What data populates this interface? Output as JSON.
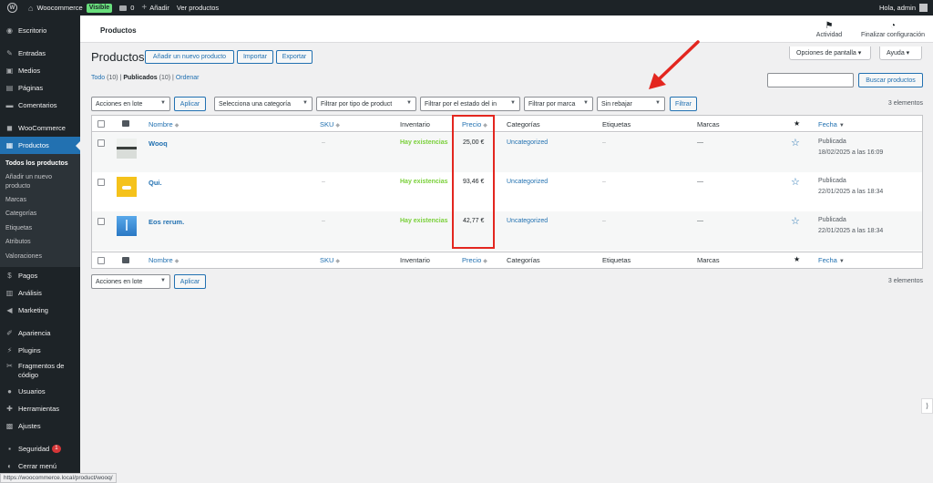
{
  "admin_bar": {
    "site_name": "Woocommerce",
    "visibility_badge": "Visible",
    "comments_count": "0",
    "new_label": "Añadir",
    "view_products": "Ver productos",
    "greeting": "Hola, admin"
  },
  "sidebar": {
    "items": [
      {
        "label": "Escritorio",
        "icon": "dashboard-icon"
      },
      {
        "label": "Entradas",
        "icon": "pin-icon"
      },
      {
        "label": "Medios",
        "icon": "media-icon"
      },
      {
        "label": "Páginas",
        "icon": "pages-icon"
      },
      {
        "label": "Comentarios",
        "icon": "comment-icon"
      },
      {
        "label": "WooCommerce",
        "icon": "woo-icon"
      },
      {
        "label": "Productos",
        "icon": "products-icon"
      }
    ],
    "submenu": [
      "Todos los productos",
      "Añadir un nuevo producto",
      "Marcas",
      "Categorías",
      "Etiquetas",
      "Atributos",
      "Valoraciones"
    ],
    "items_after": [
      {
        "label": "Pagos",
        "icon": "payments-icon"
      },
      {
        "label": "Análisis",
        "icon": "analytics-icon"
      },
      {
        "label": "Marketing",
        "icon": "megaphone-icon"
      },
      {
        "label": "Apariencia",
        "icon": "brush-icon"
      },
      {
        "label": "Plugins",
        "icon": "plugin-icon"
      },
      {
        "label": "Fragmentos de código",
        "icon": "code-icon"
      },
      {
        "label": "Usuarios",
        "icon": "users-icon"
      },
      {
        "label": "Herramientas",
        "icon": "wrench-icon"
      },
      {
        "label": "Ajustes",
        "icon": "settings-icon"
      },
      {
        "label": "Seguridad",
        "icon": "shield-icon",
        "badge": "1"
      },
      {
        "label": "Cerrar menú",
        "icon": "collapse-icon"
      }
    ]
  },
  "header": {
    "title": "Productos",
    "activity": "Actividad",
    "finish_setup": "Finalizar configuración",
    "screen_options": "Opciones de pantalla ▾",
    "help": "Ayuda ▾"
  },
  "page": {
    "title": "Productos",
    "add_new": "Añadir un nuevo producto",
    "import": "Importar",
    "export": "Exportar",
    "filters": {
      "all": "Todo",
      "all_count": "(10)",
      "published": "Publicados",
      "published_count": "(10)",
      "sort": "Ordenar",
      "sep": "|"
    },
    "search_button": "Buscar productos",
    "bulk_action": "Acciones en lote",
    "apply": "Aplicar",
    "category_select": "Selecciona una categoría",
    "type_select": "Filtrar por tipo de product",
    "stock_select": "Filtrar por el estado del in",
    "brand_select": "Filtrar por marca",
    "sale_select": "Sin rebajar",
    "filter_button": "Filtrar",
    "items_count": "3 elementos"
  },
  "table": {
    "columns": {
      "name": "Nombre",
      "sku": "SKU",
      "inventory": "Inventario",
      "price": "Precio",
      "categories": "Categorías",
      "tags": "Etiquetas",
      "brands": "Marcas",
      "date": "Fecha"
    },
    "rows": [
      {
        "name": "Wooq",
        "sku": "–",
        "stock": "Hay existencias",
        "price": "25,00 €",
        "category": "Uncategorized",
        "tags": "–",
        "brands": "—",
        "status": "Publicada",
        "date": "18/02/2025 a las 16:09",
        "thumb_color": "#9aa7a0"
      },
      {
        "name": "Qui.",
        "sku": "–",
        "stock": "Hay existencias",
        "price": "93,46 €",
        "category": "Uncategorized",
        "tags": "–",
        "brands": "—",
        "status": "Publicada",
        "date": "22/01/2025 a las 18:34",
        "thumb_color": "#f5c21b"
      },
      {
        "name": "Eos rerum.",
        "sku": "–",
        "stock": "Hay existencias",
        "price": "42,77 €",
        "category": "Uncategorized",
        "tags": "–",
        "brands": "—",
        "status": "Publicada",
        "date": "22/01/2025 a las 18:34",
        "thumb_color": "#3d8fd8"
      }
    ]
  },
  "status_url": "https://woocommerce.local/product/wooq/",
  "colors": {
    "accent": "#2271b1",
    "stock": "#7ad03a",
    "highlight": "#e3261f"
  }
}
